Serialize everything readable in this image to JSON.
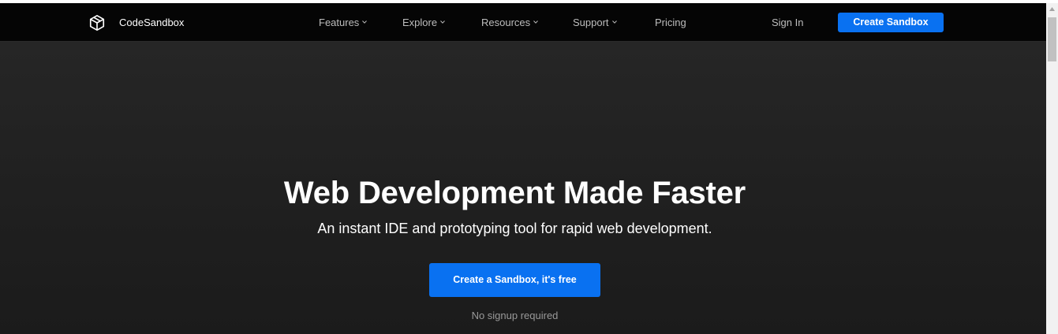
{
  "brand": {
    "name": "CodeSandbox",
    "logo_icon": "codesandbox-cube-icon"
  },
  "nav": {
    "items": [
      {
        "label": "Features",
        "has_dropdown": true
      },
      {
        "label": "Explore",
        "has_dropdown": true
      },
      {
        "label": "Resources",
        "has_dropdown": true
      },
      {
        "label": "Support",
        "has_dropdown": true
      },
      {
        "label": "Pricing",
        "has_dropdown": false
      }
    ],
    "sign_in": "Sign In",
    "cta": "Create Sandbox"
  },
  "hero": {
    "title": "Web Development Made Faster",
    "subtitle": "An instant IDE and prototyping tool for rapid web development.",
    "cta": "Create a Sandbox, it's free",
    "note": "No signup required"
  },
  "colors": {
    "accent": "#0971f1",
    "nav_bg": "#050505",
    "hero_bg": "#1f1f1f",
    "text_muted": "#999999"
  }
}
